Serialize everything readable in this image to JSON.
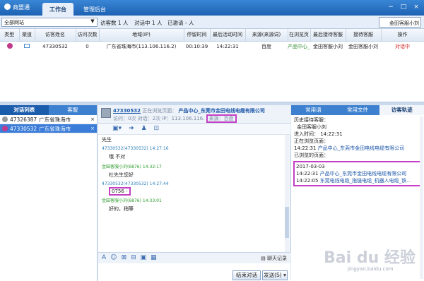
{
  "app": {
    "name": "商盟通",
    "tabs": [
      "工作台",
      "管理后台"
    ],
    "window_buttons": [
      "−",
      "□",
      "×"
    ]
  },
  "toolbar": {
    "site_select": "全部网站",
    "visitor_count": "访客数 1 人",
    "in_chat": "对话中 1 人",
    "invited": "已邀请 - 人",
    "user": "金田客服小刘"
  },
  "visitor_table": {
    "headers": [
      "类型",
      "渠道",
      "访客姓名",
      "访问次数",
      "地域(IP)",
      "停留时间",
      "最后活动时间",
      "来源(来源词)",
      "在浏览页",
      "最后接待客服",
      "接待客服",
      "操作"
    ],
    "rows": [
      {
        "name": "47330532",
        "visits": "0",
        "region": "广东省珠海市(113.106.116.2)",
        "stay": "00:10:39",
        "last_active": "14:22:31",
        "source": "百度",
        "page": "产品中心_东",
        "last_service": "金田客服小刘",
        "service": "金田客服小刘",
        "status": "对话中"
      }
    ]
  },
  "conv_list": {
    "tabs": [
      "对话列表",
      "客服"
    ],
    "items": [
      {
        "id": "47326387",
        "region": "广东省珠海市",
        "close": "×"
      },
      {
        "id": "47330532",
        "region": "广东省珠海市",
        "close": "×"
      }
    ]
  },
  "chat": {
    "visitor_id": "47330532",
    "browsing_label": "正在浏览页面：",
    "page": "产品中心_东莞市金田电线电缆有限公司",
    "visit_info": "访问：0次 对话：2次 IP：113.106.116.",
    "source_label": "来源：百度",
    "messages": [
      {
        "meta": "",
        "text": "先生",
        "kind": "first"
      },
      {
        "meta": "47330532(47330532)  14:27:16",
        "text": "哦 不对",
        "kind": "v"
      },
      {
        "meta": "金田客服小刘(6876)  14:32:17",
        "text": "杜先生您好",
        "kind": "a"
      },
      {
        "meta": "47330532(47330532)  14:27:44",
        "text": "0756 -",
        "kind": "v"
      },
      {
        "meta": "金田客服小刘(6876)  14:33:01",
        "text": "好的，稍等",
        "kind": "a"
      }
    ],
    "history_link": "聊天记录",
    "end_button": "结束对话",
    "send_button": "发送(S) ▾"
  },
  "right_panel": {
    "tabs": [
      "常用语",
      "常用文件",
      "访客轨迹"
    ],
    "track": {
      "history_label": "历史接待客服：",
      "history_agent": "金田客服小刘",
      "enter_time": "进入时间： 14:22:31",
      "browsing_label": "正在浏览页面：",
      "current_page_time": "14:22:31",
      "current_page": "产品中心_东莞市金田电线电缆有限公司",
      "visited_label": "已浏览的页面：",
      "date": "2017-03-03",
      "entries": [
        {
          "time": "14:22:31",
          "page": "产品中心_东莞市金田电线电缆有限公司"
        },
        {
          "time": "14:22:05",
          "page": "东莞电线电缆_拖链电缆_机器人电缆_铁…"
        }
      ]
    }
  },
  "watermark": {
    "logo": "Bai du 经验",
    "url": "jingyan.baidu.com"
  }
}
